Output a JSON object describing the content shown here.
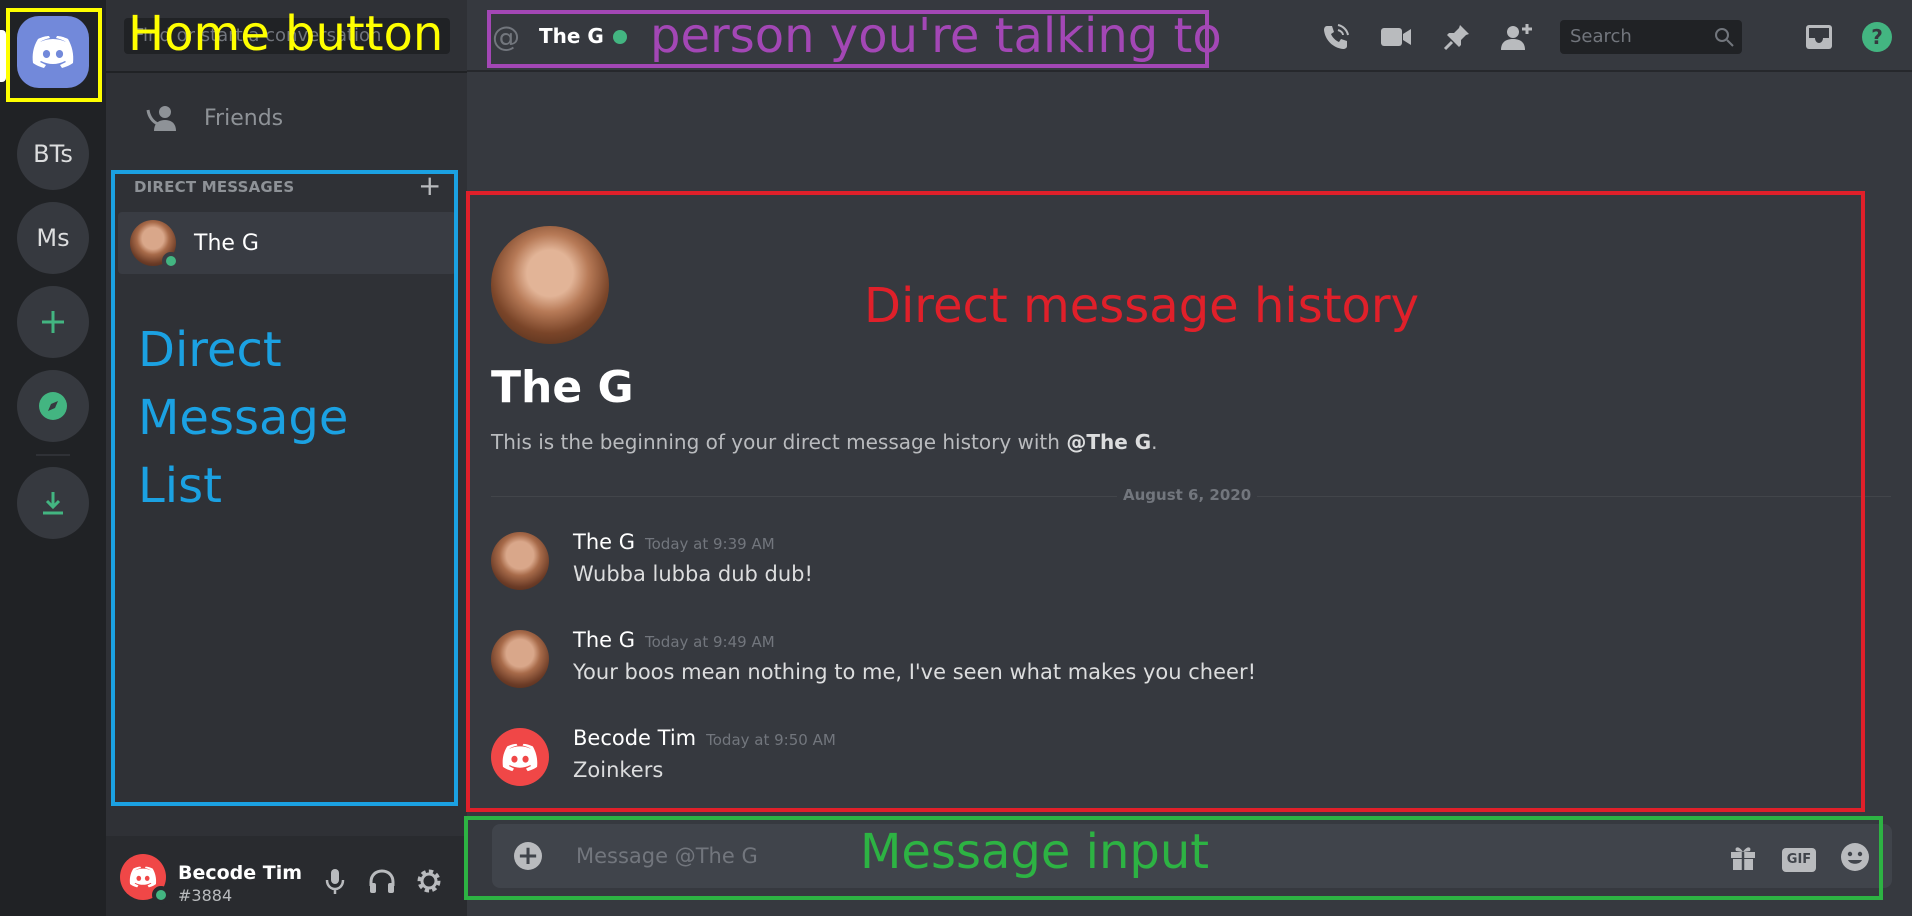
{
  "rail": {
    "servers": [
      {
        "label": "BTs"
      },
      {
        "label": "Ms"
      }
    ]
  },
  "sidebar": {
    "search_placeholder": "Find or start a conversation",
    "friends_label": "Friends",
    "dm_header": "DIRECT MESSAGES",
    "dm_items": [
      {
        "name": "The G",
        "status": "online"
      }
    ]
  },
  "user": {
    "name": "Becode Tim",
    "tag": "#3884"
  },
  "header": {
    "name": "The G",
    "search_placeholder": "Search"
  },
  "chat": {
    "title": "The G",
    "intro_prefix": "This is the beginning of your direct message history with ",
    "intro_mention": "@The G",
    "intro_suffix": ".",
    "date_divider": "August 6, 2020",
    "messages": [
      {
        "author": "The G",
        "time": "Today at 9:39 AM",
        "text": "Wubba lubba dub dub!"
      },
      {
        "author": "The G",
        "time": "Today at 9:49 AM",
        "text": "Your boos mean nothing to me, I've seen what makes you cheer!"
      },
      {
        "author": "Becode Tim",
        "time": "Today at 9:50 AM",
        "text": "Zoinkers"
      }
    ]
  },
  "composer": {
    "placeholder": "Message @The G",
    "gif_label": "GIF"
  },
  "annotations": {
    "home": {
      "text": "Home button",
      "color": "#ffff00"
    },
    "person": {
      "text": "person you're talking to",
      "color": "#a347b5"
    },
    "dm_list": {
      "lines": [
        "Direct",
        "Message",
        "List"
      ],
      "color": "#1ba1e2"
    },
    "history": {
      "text": "Direct message history",
      "color": "#e0202a"
    },
    "input": {
      "text": "Message input",
      "color": "#2db343"
    }
  },
  "colors": {
    "blurple": "#7289da",
    "online": "#43b581",
    "red_avatar": "#f04747"
  }
}
